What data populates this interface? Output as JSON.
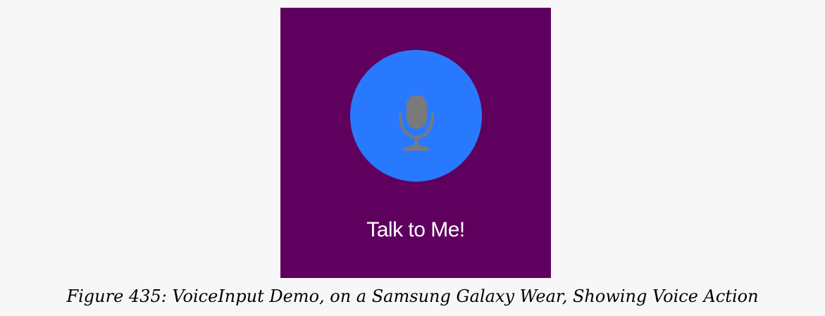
{
  "screen": {
    "background_color": "#5f005f",
    "voice_button": {
      "icon": "microphone-icon",
      "color": "#2979ff",
      "icon_color": "#7a7a7a"
    },
    "prompt_label": "Talk to Me!"
  },
  "caption": "Figure 435: VoiceInput Demo, on a Samsung Galaxy Wear, Showing Voice Action"
}
